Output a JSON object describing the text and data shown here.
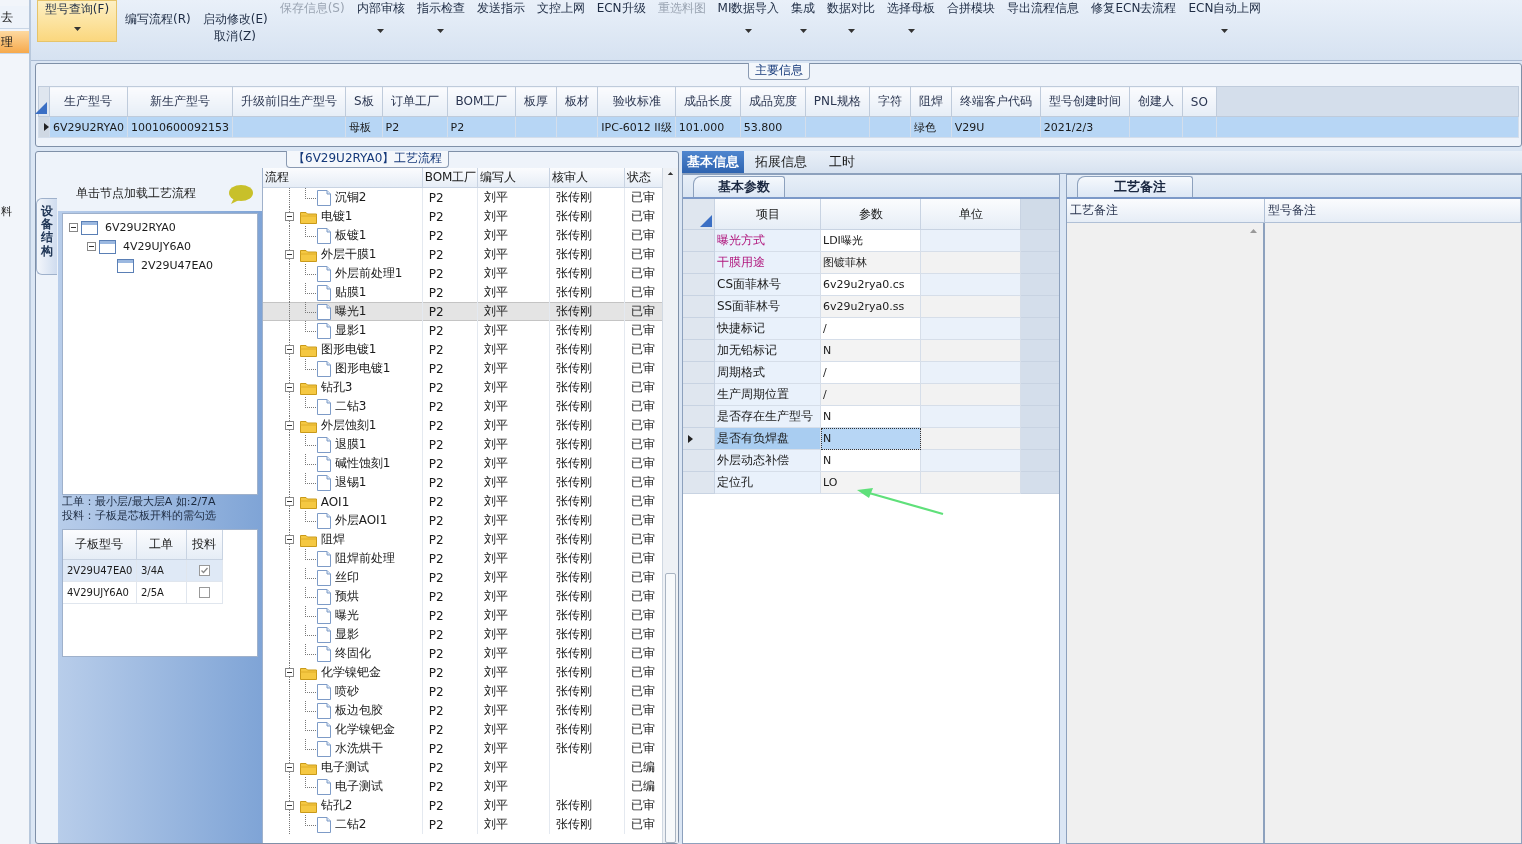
{
  "left_nav": {
    "items": [
      {
        "label": "去",
        "selected": false
      },
      {
        "label": "理",
        "selected": true
      }
    ],
    "lower_label": "料"
  },
  "ribbon": [
    {
      "lines": [
        "型号查询(F)"
      ],
      "kind": "large",
      "highlighted": true,
      "disabled": false,
      "dropdown": true
    },
    {
      "lines": [
        "编写流程(R)"
      ],
      "kind": "small",
      "highlighted": false,
      "disabled": false,
      "dropdown": false
    },
    {
      "lines": [
        "启动修改(E)",
        "取消(Z)"
      ],
      "kind": "small",
      "highlighted": false,
      "disabled": false,
      "dropdown": false
    },
    {
      "lines": [
        "保存信息(S)"
      ],
      "kind": "large",
      "highlighted": false,
      "disabled": true,
      "dropdown": false
    },
    {
      "lines": [
        "内部审核"
      ],
      "kind": "large",
      "highlighted": false,
      "disabled": false,
      "dropdown": true
    },
    {
      "lines": [
        "指示检查"
      ],
      "kind": "large",
      "highlighted": false,
      "disabled": false,
      "dropdown": true
    },
    {
      "lines": [
        "发送指示"
      ],
      "kind": "large",
      "highlighted": false,
      "disabled": false,
      "dropdown": false
    },
    {
      "lines": [
        "文控上网"
      ],
      "kind": "large",
      "highlighted": false,
      "disabled": false,
      "dropdown": false
    },
    {
      "lines": [
        "ECN升级"
      ],
      "kind": "large",
      "highlighted": false,
      "disabled": false,
      "dropdown": false
    },
    {
      "lines": [
        "重选料图"
      ],
      "kind": "large",
      "highlighted": false,
      "disabled": true,
      "dropdown": false
    },
    {
      "lines": [
        "MI数据导入"
      ],
      "kind": "large",
      "highlighted": false,
      "disabled": false,
      "dropdown": true
    },
    {
      "lines": [
        "集成"
      ],
      "kind": "large",
      "highlighted": false,
      "disabled": false,
      "dropdown": true
    },
    {
      "lines": [
        "数据对比"
      ],
      "kind": "large",
      "highlighted": false,
      "disabled": false,
      "dropdown": true
    },
    {
      "lines": [
        "选择母板"
      ],
      "kind": "large",
      "highlighted": false,
      "disabled": false,
      "dropdown": true
    },
    {
      "lines": [
        "合拼模块"
      ],
      "kind": "large",
      "highlighted": false,
      "disabled": false,
      "dropdown": false
    },
    {
      "lines": [
        "导出流程信息"
      ],
      "kind": "large",
      "highlighted": false,
      "disabled": false,
      "dropdown": false
    },
    {
      "lines": [
        "修复ECN去流程"
      ],
      "kind": "large",
      "highlighted": false,
      "disabled": false,
      "dropdown": false
    },
    {
      "lines": [
        "ECN自动上网"
      ],
      "kind": "large",
      "highlighted": false,
      "disabled": false,
      "dropdown": true
    }
  ],
  "main_info": {
    "title": "主要信息",
    "columns": [
      "生产型号",
      "新生产型号",
      "升级前旧生产型号",
      "S板",
      "订单工厂",
      "BOM工厂",
      "板厚",
      "板材",
      "验收标准",
      "成品长度",
      "成品宽度",
      "PNL规格",
      "字符",
      "阻焊",
      "终端客户代码",
      "型号创建时间",
      "创建人",
      "SO"
    ],
    "rows": [
      {
        "selected": true,
        "cells": [
          "6V29U2RYA0",
          "10010600092153",
          "",
          "母板",
          "P2",
          "P2",
          "",
          "",
          "IPC-6012 II级",
          "101.000",
          "53.800",
          "",
          "",
          "绿色",
          "V29U",
          "2021/2/3",
          "",
          ""
        ]
      }
    ]
  },
  "flow_panel": {
    "title": "【6V29U2RYA0】工艺流程",
    "side_tab": "设备结构",
    "hint": "单击节点加载工艺流程",
    "device_tree": [
      {
        "code": "6V29U2RYA0",
        "expanded": true,
        "children": [
          {
            "code": "4V29UJY6A0",
            "expanded": true,
            "children": [
              {
                "code": "2V29U47EA0"
              }
            ]
          }
        ]
      }
    ],
    "notes": [
      "工单：最小层/最大层A 如:2/7A",
      "投料：子板是芯板开料的需勾选"
    ],
    "sub_boards": {
      "columns": [
        "子板型号",
        "工单",
        "投料"
      ],
      "rows": [
        {
          "code": "2V29U47EA0",
          "order": "3/4A",
          "feed": true,
          "selected": true
        },
        {
          "code": "4V29UJY6A0",
          "order": "2/5A",
          "feed": false,
          "selected": false
        }
      ]
    },
    "flow_columns": [
      "流程",
      "BOM工厂",
      "编写人",
      "核审人",
      "状态"
    ],
    "flow": [
      {
        "children": [
          {
            "name": "沉铜2",
            "factory": "P2",
            "writer": "刘平",
            "reviewer": "张传刚",
            "status": "已审",
            "selected": false
          }
        ]
      },
      {
        "name": "电镀1",
        "factory": "P2",
        "writer": "刘平",
        "reviewer": "张传刚",
        "status": "已审",
        "expanded": true,
        "selected": false,
        "children": [
          {
            "name": "板镀1",
            "factory": "P2",
            "writer": "刘平",
            "reviewer": "张传刚",
            "status": "已审",
            "selected": false
          }
        ]
      },
      {
        "name": "外层干膜1",
        "factory": "P2",
        "writer": "刘平",
        "reviewer": "张传刚",
        "status": "已审",
        "expanded": true,
        "selected": false,
        "children": [
          {
            "name": "外层前处理1",
            "factory": "P2",
            "writer": "刘平",
            "reviewer": "张传刚",
            "status": "已审",
            "selected": false
          },
          {
            "name": "贴膜1",
            "factory": "P2",
            "writer": "刘平",
            "reviewer": "张传刚",
            "status": "已审",
            "selected": false
          },
          {
            "name": "曝光1",
            "factory": "P2",
            "writer": "刘平",
            "reviewer": "张传刚",
            "status": "已审",
            "selected": true
          },
          {
            "name": "显影1",
            "factory": "P2",
            "writer": "刘平",
            "reviewer": "张传刚",
            "status": "已审",
            "selected": false
          }
        ]
      },
      {
        "name": "图形电镀1",
        "factory": "P2",
        "writer": "刘平",
        "reviewer": "张传刚",
        "status": "已审",
        "expanded": true,
        "selected": false,
        "children": [
          {
            "name": "图形电镀1",
            "factory": "P2",
            "writer": "刘平",
            "reviewer": "张传刚",
            "status": "已审",
            "selected": false
          }
        ]
      },
      {
        "name": "钻孔3",
        "factory": "P2",
        "writer": "刘平",
        "reviewer": "张传刚",
        "status": "已审",
        "expanded": true,
        "selected": false,
        "children": [
          {
            "name": "二钻3",
            "factory": "P2",
            "writer": "刘平",
            "reviewer": "张传刚",
            "status": "已审",
            "selected": false
          }
        ]
      },
      {
        "name": "外层蚀刻1",
        "factory": "P2",
        "writer": "刘平",
        "reviewer": "张传刚",
        "status": "已审",
        "expanded": true,
        "selected": false,
        "children": [
          {
            "name": "退膜1",
            "factory": "P2",
            "writer": "刘平",
            "reviewer": "张传刚",
            "status": "已审",
            "selected": false
          },
          {
            "name": "碱性蚀刻1",
            "factory": "P2",
            "writer": "刘平",
            "reviewer": "张传刚",
            "status": "已审",
            "selected": false
          },
          {
            "name": "退锡1",
            "factory": "P2",
            "writer": "刘平",
            "reviewer": "张传刚",
            "status": "已审",
            "selected": false
          }
        ]
      },
      {
        "name": "AOI1",
        "factory": "P2",
        "writer": "刘平",
        "reviewer": "张传刚",
        "status": "已审",
        "expanded": true,
        "selected": false,
        "children": [
          {
            "name": "外层AOI1",
            "factory": "P2",
            "writer": "刘平",
            "reviewer": "张传刚",
            "status": "已审",
            "selected": false
          }
        ]
      },
      {
        "name": "阻焊",
        "factory": "P2",
        "writer": "刘平",
        "reviewer": "张传刚",
        "status": "已审",
        "expanded": true,
        "selected": false,
        "children": [
          {
            "name": "阻焊前处理",
            "factory": "P2",
            "writer": "刘平",
            "reviewer": "张传刚",
            "status": "已审",
            "selected": false
          },
          {
            "name": "丝印",
            "factory": "P2",
            "writer": "刘平",
            "reviewer": "张传刚",
            "status": "已审",
            "selected": false
          },
          {
            "name": "预烘",
            "factory": "P2",
            "writer": "刘平",
            "reviewer": "张传刚",
            "status": "已审",
            "selected": false
          },
          {
            "name": "曝光",
            "factory": "P2",
            "writer": "刘平",
            "reviewer": "张传刚",
            "status": "已审",
            "selected": false
          },
          {
            "name": "显影",
            "factory": "P2",
            "writer": "刘平",
            "reviewer": "张传刚",
            "status": "已审",
            "selected": false
          },
          {
            "name": "终固化",
            "factory": "P2",
            "writer": "刘平",
            "reviewer": "张传刚",
            "status": "已审",
            "selected": false
          }
        ]
      },
      {
        "name": "化学镍钯金",
        "factory": "P2",
        "writer": "刘平",
        "reviewer": "张传刚",
        "status": "已审",
        "expanded": true,
        "selected": false,
        "children": [
          {
            "name": "喷砂",
            "factory": "P2",
            "writer": "刘平",
            "reviewer": "张传刚",
            "status": "已审",
            "selected": false
          },
          {
            "name": "板边包胶",
            "factory": "P2",
            "writer": "刘平",
            "reviewer": "张传刚",
            "status": "已审",
            "selected": false
          },
          {
            "name": "化学镍钯金",
            "factory": "P2",
            "writer": "刘平",
            "reviewer": "张传刚",
            "status": "已审",
            "selected": false
          },
          {
            "name": "水洗烘干",
            "factory": "P2",
            "writer": "刘平",
            "reviewer": "张传刚",
            "status": "已审",
            "selected": false
          }
        ]
      },
      {
        "name": "电子测试",
        "factory": "P2",
        "writer": "刘平",
        "status": "已编",
        "expanded": true,
        "selected": false,
        "children": [
          {
            "name": "电子测试",
            "factory": "P2",
            "writer": "刘平",
            "status": "已编",
            "selected": false
          }
        ]
      },
      {
        "name": "钻孔2",
        "factory": "P2",
        "writer": "刘平",
        "reviewer": "张传刚",
        "status": "已审",
        "expanded": true,
        "selected": false,
        "children": [
          {
            "name": "二钻2",
            "factory": "P2",
            "writer": "刘平",
            "reviewer": "张传刚",
            "status": "已审",
            "selected": false
          }
        ]
      }
    ]
  },
  "detail_tabs": [
    {
      "label": "基本信息",
      "selected": true
    },
    {
      "label": "拓展信息",
      "selected": false
    },
    {
      "label": "工时",
      "selected": false
    }
  ],
  "params": {
    "tab": "基本参数",
    "columns": [
      "项目",
      "参数",
      "单位"
    ],
    "rows": [
      {
        "item": "曝光方式",
        "value": "LDI曝光",
        "highlight": true,
        "selected": false
      },
      {
        "item": "干膜用途",
        "value": "图镀菲林",
        "highlight": true,
        "selected": false
      },
      {
        "item": "CS面菲林号",
        "value": "6v29u2rya0.cs",
        "highlight": false,
        "selected": false
      },
      {
        "item": "SS面菲林号",
        "value": "6v29u2rya0.ss",
        "highlight": false,
        "selected": false
      },
      {
        "item": "快捷标记",
        "value": "/",
        "highlight": false,
        "selected": false
      },
      {
        "item": "加无铅标记",
        "value": "N",
        "highlight": false,
        "selected": false
      },
      {
        "item": "周期格式",
        "value": "/",
        "highlight": false,
        "selected": false
      },
      {
        "item": "生产周期位置",
        "value": "/",
        "highlight": false,
        "selected": false
      },
      {
        "item": "是否存在生产型号",
        "value": "N",
        "highlight": false,
        "selected": false
      },
      {
        "item": "是否有负焊盘",
        "value": "N",
        "highlight": false,
        "selected": true
      },
      {
        "item": "外层动态补偿",
        "value": "N",
        "highlight": false,
        "selected": false
      },
      {
        "item": "定位孔",
        "value": "LO",
        "highlight": false,
        "selected": false
      }
    ]
  },
  "remarks": {
    "tab": "工艺备注",
    "columns": [
      "工艺备注",
      "型号备注"
    ]
  }
}
